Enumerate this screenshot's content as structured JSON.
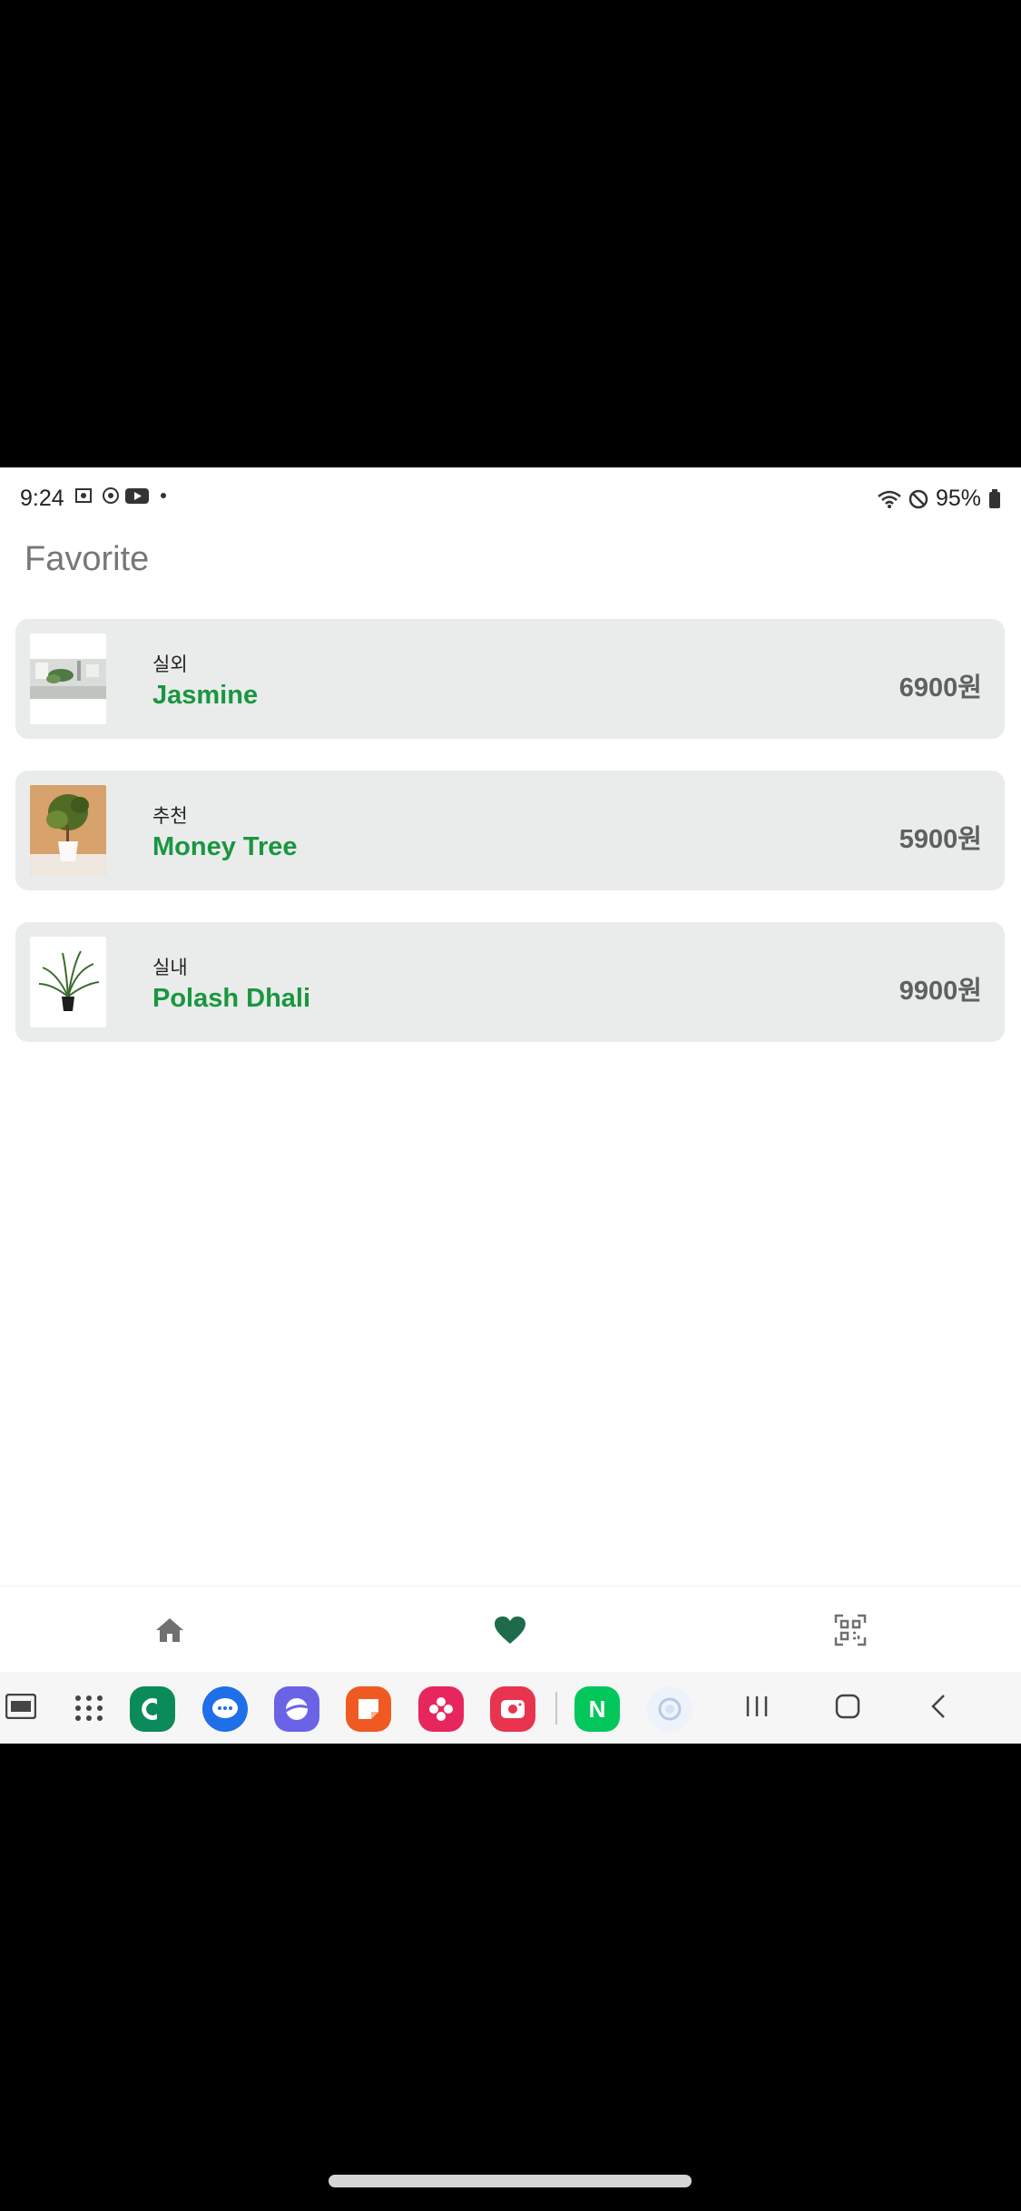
{
  "status_bar": {
    "time": "9:24",
    "battery": "95%"
  },
  "page": {
    "title": "Favorite"
  },
  "favorites": [
    {
      "category": "실외",
      "name": "Jasmine",
      "price": "6900원"
    },
    {
      "category": "추천",
      "name": "Money Tree",
      "price": "5900원"
    },
    {
      "category": "실내",
      "name": "Polash Dhali",
      "price": "9900원"
    }
  ],
  "colors": {
    "accent_green": "#1a9640",
    "nav_active": "#1e6b4c",
    "card_bg": "#e9ecea",
    "price_gray": "#5f6060"
  },
  "bottom_nav": [
    {
      "icon": "home-icon",
      "active": false
    },
    {
      "icon": "heart-icon",
      "active": true
    },
    {
      "icon": "qr-scan-icon",
      "active": false
    }
  ],
  "taskbar": {
    "apps": [
      "phone-app-icon",
      "messages-app-icon",
      "internet-app-icon",
      "memo-app-icon",
      "gallery-app-icon",
      "camera-app-icon",
      "naver-app-icon",
      "assistant-app-icon"
    ],
    "naver_letter": "N"
  }
}
